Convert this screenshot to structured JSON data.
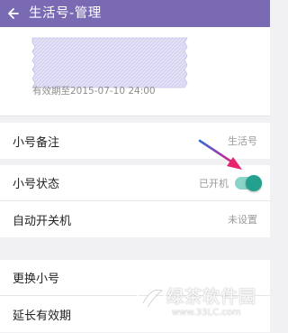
{
  "appbar": {
    "title": "生活号-管理"
  },
  "card": {
    "validity": "有效期至2015-07-10 24:00"
  },
  "settings": {
    "remark": {
      "label": "小号备注",
      "value": "生活号"
    },
    "status": {
      "label": "小号状态",
      "value": "已开机",
      "toggle_on": true
    },
    "auto_power": {
      "label": "自动开关机",
      "value": "未设置"
    },
    "change_number": {
      "label": "更换小号"
    },
    "extend_validity": {
      "label": "延长有效期"
    }
  },
  "watermark": {
    "name": "绿茶软件园",
    "url": "www.33LC.com"
  },
  "colors": {
    "appbar": "#7a69b3",
    "toggle_track": "#8ad3c7",
    "toggle_knob": "#23a08e",
    "arrow": "#e8246f"
  }
}
